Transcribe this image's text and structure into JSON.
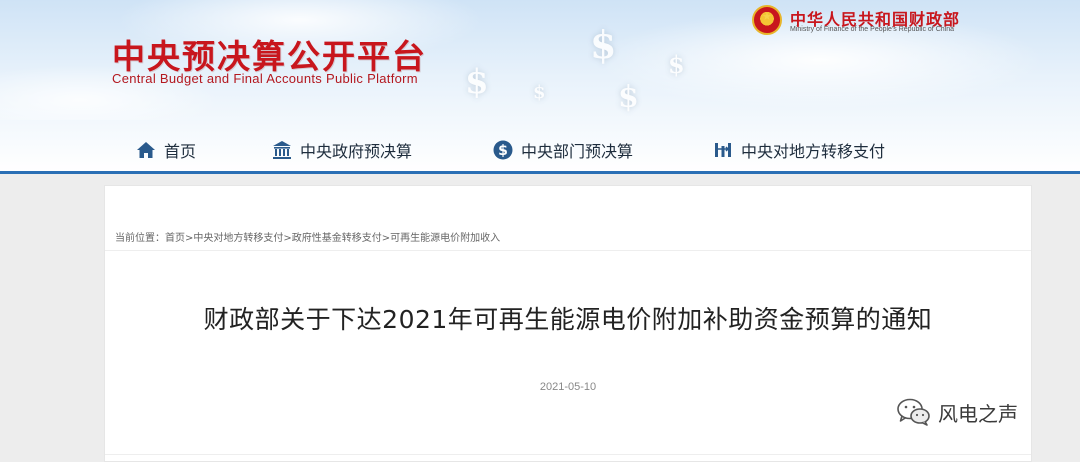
{
  "header": {
    "site_title": "中央预决算公开平台",
    "site_subtitle": "Central Budget and Final Accounts Public Platform",
    "ministry_name": "中华人民共和国财政部",
    "ministry_en": "Ministry of Finance of the People's Republic of China",
    "emblem_icon": "national-emblem-icon",
    "brand_color": "#c8161d"
  },
  "nav": {
    "items": [
      {
        "label": "首页",
        "icon": "home-icon"
      },
      {
        "label": "中央政府预决算",
        "icon": "government-building-icon"
      },
      {
        "label": "中央部门预决算",
        "icon": "dollar-circle-icon"
      },
      {
        "label": "中央对地方转移支付",
        "icon": "transfer-icon"
      }
    ],
    "accent_color": "#2a6fb5"
  },
  "breadcrumb": {
    "prefix": "当前位置：",
    "items": [
      "首页",
      "中央对地方转移支付",
      "政府性基金转移支付",
      "可再生能源电价附加收入"
    ],
    "separator": ">"
  },
  "article": {
    "title": "财政部关于下达2021年可再生能源电价附加补助资金预算的通知",
    "date": "2021-05-10"
  },
  "watermark": {
    "text": "风电之声",
    "icon": "wechat-icon"
  }
}
